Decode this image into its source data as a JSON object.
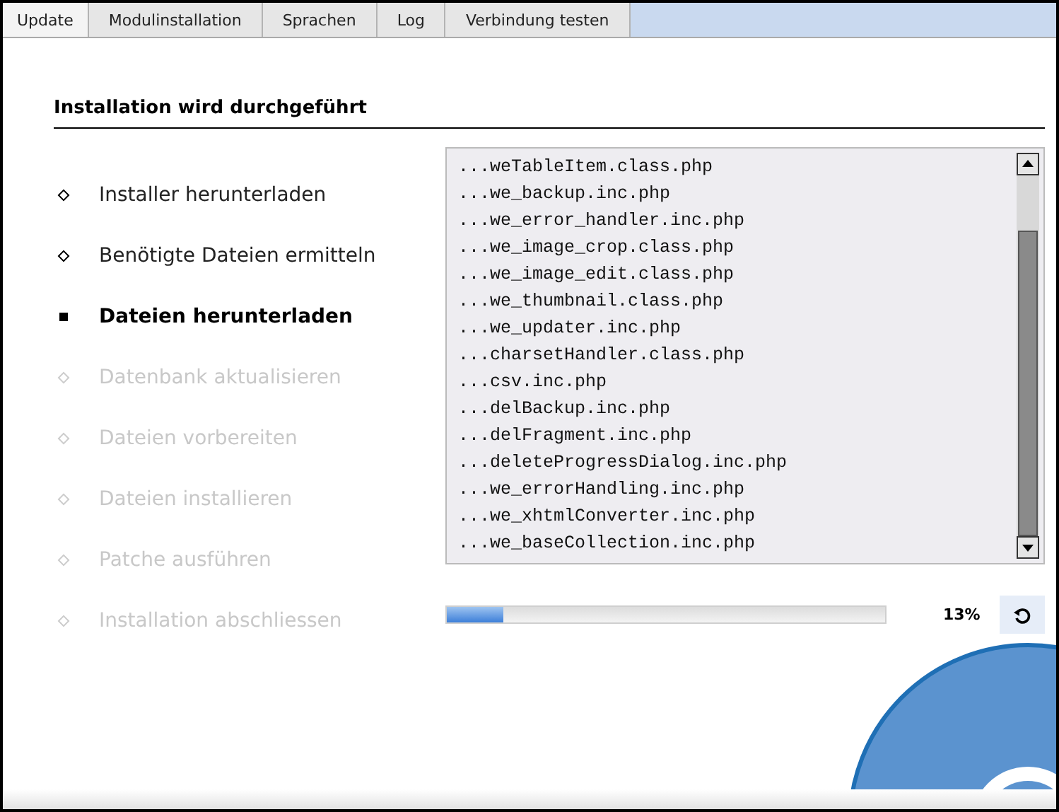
{
  "tabs": [
    {
      "label": "Update",
      "selected": true
    },
    {
      "label": "Modulinstallation",
      "selected": false
    },
    {
      "label": "Sprachen",
      "selected": false
    },
    {
      "label": "Log",
      "selected": false
    },
    {
      "label": "Verbindung testen",
      "selected": false
    }
  ],
  "heading": "Installation wird durchgeführt",
  "steps": [
    {
      "label": "Installer herunterladen",
      "kind": "done"
    },
    {
      "label": "Benötigte Dateien ermitteln",
      "kind": "done"
    },
    {
      "label": "Dateien herunterladen",
      "kind": "current"
    },
    {
      "label": "Datenbank aktualisieren",
      "kind": "pending"
    },
    {
      "label": "Dateien vorbereiten",
      "kind": "pending"
    },
    {
      "label": "Dateien installieren",
      "kind": "pending"
    },
    {
      "label": "Patche ausführen",
      "kind": "pending"
    },
    {
      "label": "Installation abschliessen",
      "kind": "pending"
    }
  ],
  "log_lines": [
    "...weTableItem.class.php",
    "...we_backup.inc.php",
    "...we_error_handler.inc.php",
    "...we_image_crop.class.php",
    "...we_image_edit.class.php",
    "...we_thumbnail.class.php",
    "...we_updater.inc.php",
    "...charsetHandler.class.php",
    "...csv.inc.php",
    "...delBackup.inc.php",
    "...delFragment.inc.php",
    "...deleteProgressDialog.inc.php",
    "...we_errorHandling.inc.php",
    "...we_xhtmlConverter.inc.php",
    "...we_baseCollection.inc.php"
  ],
  "progress": {
    "level": 0.13,
    "reading": "13%"
  }
}
